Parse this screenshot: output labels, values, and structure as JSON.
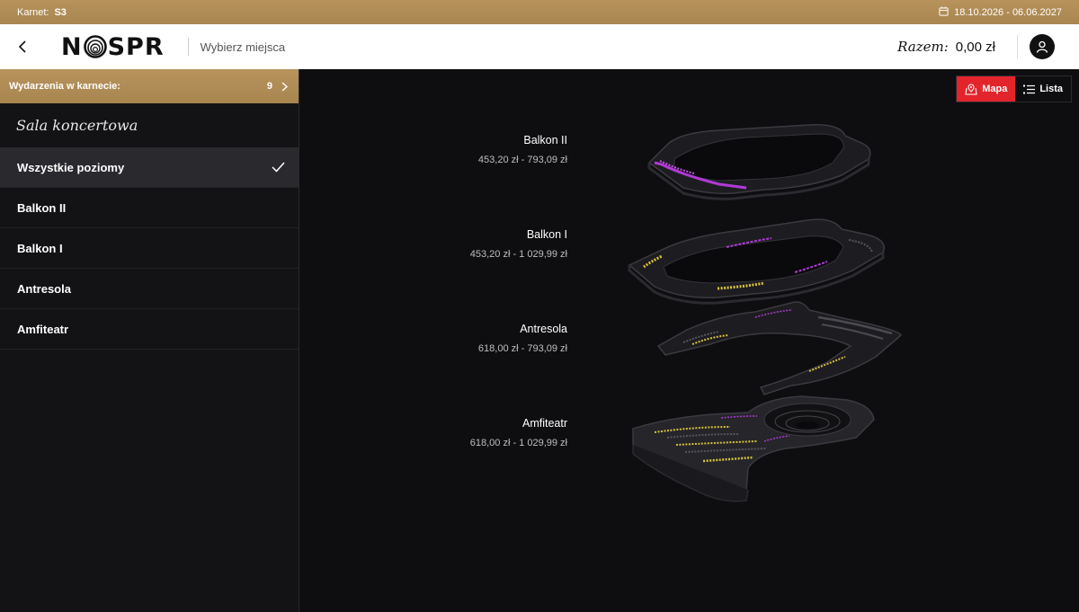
{
  "topbar": {
    "pass_label": "Karnet:",
    "pass_value": "S3",
    "date_range": "18.10.2026 - 06.06.2027"
  },
  "header": {
    "logo_text_left": "N",
    "logo_text_right": "SPR",
    "subtitle": "Wybierz miejsca",
    "total_label": "Razem:",
    "total_value": "0,00 zł"
  },
  "sidebar": {
    "events_label": "Wydarzenia w karnecie:",
    "events_count": "9",
    "venue": "Sala koncertowa",
    "levels": [
      {
        "label": "Wszystkie poziomy",
        "active": true
      },
      {
        "label": "Balkon II"
      },
      {
        "label": "Balkon I"
      },
      {
        "label": "Antresola"
      },
      {
        "label": "Amfiteatr"
      }
    ]
  },
  "view_toggle": {
    "map_label": "Mapa",
    "list_label": "Lista"
  },
  "floors": [
    {
      "name": "Balkon II",
      "price": "453,20 zł - 793,09 zł"
    },
    {
      "name": "Balkon I",
      "price": "453,20 zł - 1 029,99 zł"
    },
    {
      "name": "Antresola",
      "price": "618,00 zł - 793,09 zł"
    },
    {
      "name": "Amfiteatr",
      "price": "618,00 zł - 1 029,99 zł"
    }
  ],
  "colors": {
    "gold": "#b08c56",
    "accent_red": "#e3242b",
    "seat_purple": "#b03ad6",
    "seat_yellow": "#d9c23a"
  },
  "icons": [
    "calendar-icon",
    "back-arrow-icon",
    "user-icon",
    "chevron-right-icon",
    "check-icon",
    "map-pin-icon",
    "list-icon"
  ]
}
